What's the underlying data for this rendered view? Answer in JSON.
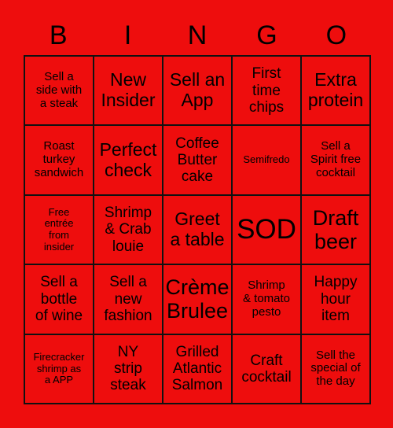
{
  "card": {
    "title": "BINGO",
    "background_color": "#ee0d0d",
    "text_color": "#000000",
    "border_color": "#111111",
    "header_letters": [
      "B",
      "I",
      "N",
      "G",
      "O"
    ],
    "rows": [
      [
        {
          "text": "Sell a\nside with\na steak",
          "size": "sm"
        },
        {
          "text": "New\nInsider",
          "size": "lg"
        },
        {
          "text": "Sell an\nApp",
          "size": "lg"
        },
        {
          "text": "First\ntime\nchips",
          "size": "md"
        },
        {
          "text": "Extra\nprotein",
          "size": "lg"
        }
      ],
      [
        {
          "text": "Roast\nturkey\nsandwich",
          "size": "sm"
        },
        {
          "text": "Perfect\ncheck",
          "size": "lg"
        },
        {
          "text": "Coffee\nButter\ncake",
          "size": "md"
        },
        {
          "text": "Semifredo",
          "size": "xs"
        },
        {
          "text": "Sell a\nSpirit free\ncocktail",
          "size": "sm"
        }
      ],
      [
        {
          "text": "Free\nentrée\nfrom\ninsider",
          "size": "xs"
        },
        {
          "text": "Shrimp\n& Crab\nlouie",
          "size": "md"
        },
        {
          "text": "Greet\na table",
          "size": "lg"
        },
        {
          "text": "SOD",
          "size": "xxl"
        },
        {
          "text": "Draft\nbeer",
          "size": "xl"
        }
      ],
      [
        {
          "text": "Sell a\nbottle\nof wine",
          "size": "md"
        },
        {
          "text": "Sell a\nnew\nfashion",
          "size": "md"
        },
        {
          "text": "Crème\nBrulee",
          "size": "xl"
        },
        {
          "text": "Shrimp\n& tomato\npesto",
          "size": "sm"
        },
        {
          "text": "Happy\nhour\nitem",
          "size": "md"
        }
      ],
      [
        {
          "text": "Firecracker\nshrimp as\na APP",
          "size": "xs"
        },
        {
          "text": "NY\nstrip\nsteak",
          "size": "md"
        },
        {
          "text": "Grilled\nAtlantic\nSalmon",
          "size": "md"
        },
        {
          "text": "Craft\ncocktail",
          "size": "md"
        },
        {
          "text": "Sell the\nspecial of\nthe day",
          "size": "sm"
        }
      ]
    ]
  }
}
